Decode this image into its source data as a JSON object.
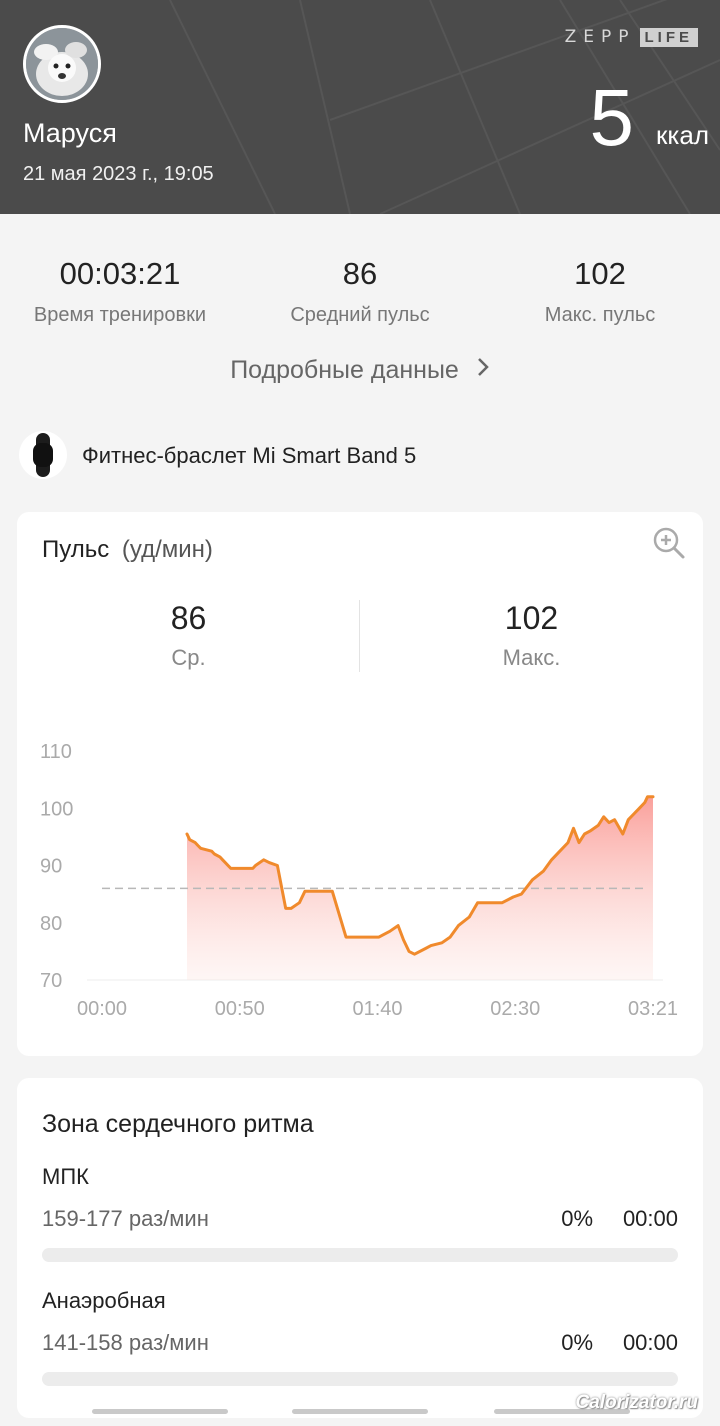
{
  "header": {
    "user_name": "Маруся",
    "date": "21 мая 2023 г., 19:05",
    "brand_left": "ZEPP",
    "brand_right": "LIFE",
    "calories_value": "5",
    "calories_unit": "ккал",
    "background_color": "#4b4b4b"
  },
  "stats": [
    {
      "value": "00:03:21",
      "label": "Время тренировки"
    },
    {
      "value": "86",
      "label": "Средний пульс"
    },
    {
      "value": "102",
      "label": "Макс. пульс"
    }
  ],
  "details_link": "Подробные данные",
  "device": {
    "name": "Фитнес-браслет Mi Smart Band 5",
    "icon": "band-icon"
  },
  "heart_rate": {
    "title": "Пульс",
    "unit": "(уд/мин)",
    "avg_value": "86",
    "avg_label": "Ср.",
    "max_value": "102",
    "max_label": "Макс.",
    "zoom_icon": "zoom-in-icon"
  },
  "chart_data": {
    "type": "area",
    "x_tick_labels": [
      "00:00",
      "00:50",
      "01:40",
      "02:30",
      "03:21"
    ],
    "y_tick_labels": [
      "110",
      "100",
      "90",
      "80",
      "70"
    ],
    "ylim": [
      70,
      110
    ],
    "xlim_seconds": [
      0,
      201
    ],
    "average_line": 86,
    "line_color": "#f08a2c",
    "fill_color": "#fa9b96",
    "x_seconds": [
      31,
      32,
      34,
      35,
      36,
      40,
      41,
      43,
      44,
      47,
      50,
      53,
      55,
      56,
      59,
      61,
      64,
      67,
      69,
      72,
      74,
      78,
      81,
      84,
      89,
      94,
      95,
      98,
      101,
      105,
      108,
      110,
      112,
      114,
      118,
      120,
      124,
      127,
      130,
      134,
      137,
      140,
      143,
      146,
      150,
      153,
      157,
      161,
      164,
      167,
      170,
      172,
      174,
      176,
      178,
      181,
      183,
      185,
      187,
      190,
      192,
      194,
      196,
      198,
      199,
      201
    ],
    "values": [
      95.5,
      94.5,
      94,
      93.5,
      93,
      92.5,
      92,
      91.5,
      91,
      89.5,
      89.5,
      89.5,
      89.5,
      90,
      91,
      90.5,
      90,
      82.5,
      82.5,
      83.5,
      85.5,
      85.5,
      85.5,
      85.5,
      77.5,
      77.5,
      77.5,
      77.5,
      77.5,
      78.5,
      79.5,
      77,
      75,
      74.5,
      75.5,
      76,
      76.5,
      77.5,
      79.5,
      81,
      83.5,
      83.5,
      83.5,
      83.5,
      84.5,
      85,
      87.5,
      89,
      91,
      92.5,
      94,
      96.5,
      94,
      95.5,
      96,
      97,
      98.5,
      97.5,
      98,
      95.5,
      98,
      99,
      100,
      101,
      102,
      102
    ]
  },
  "zones": {
    "title": "Зона сердечного ритма",
    "items": [
      {
        "name": "МПК",
        "range": "159-177 раз/мин",
        "percent": "0%",
        "time": "00:00",
        "fill": 0
      },
      {
        "name": "Анаэробная",
        "range": "141-158 раз/мин",
        "percent": "0%",
        "time": "00:00",
        "fill": 0
      }
    ]
  },
  "watermark": "Calorizator.ru"
}
